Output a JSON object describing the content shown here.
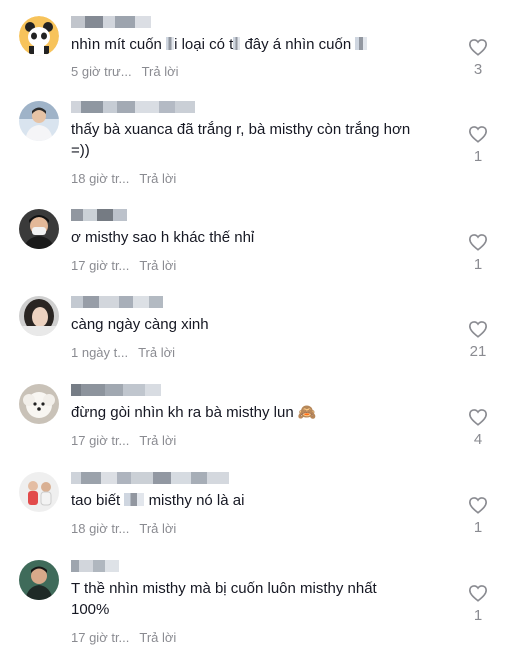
{
  "comments": [
    {
      "text_parts": [
        "nhìn mít cuốn",
        " ",
        "i loại có t",
        " ",
        "đây á nhìn cuốn",
        ""
      ],
      "time": "5 giờ trư...",
      "reply": "Trả lời",
      "likes": "3",
      "avatar": "panda-avatar"
    },
    {
      "text_parts": [
        "thấy bà xuanca đã trắng r, bà misthy còn trắng hơn\n=))"
      ],
      "time": "18 giờ tr...",
      "reply": "Trả lời",
      "likes": "1",
      "avatar": "person-avatar"
    },
    {
      "text_parts": [
        "ơ misthy sao h khác thế nhỉ"
      ],
      "time": "17 giờ tr...",
      "reply": "Trả lời",
      "likes": "1",
      "avatar": "masked-person-avatar"
    },
    {
      "text_parts": [
        "càng ngày càng xinh"
      ],
      "time": "1 ngày t...",
      "reply": "Trả lời",
      "likes": "21",
      "avatar": "girl-avatar"
    },
    {
      "text_parts": [
        "đừng gòi nhìn kh ra bà misthy lun 🙈"
      ],
      "time": "17 giờ tr...",
      "reply": "Trả lời",
      "likes": "4",
      "avatar": "dog-avatar"
    },
    {
      "text_parts": [
        "tao biết",
        " ",
        "mi",
        "misthy nó là ai"
      ],
      "time": "18 giờ tr...",
      "reply": "Trả lời",
      "likes": "1",
      "avatar": "group-avatar"
    },
    {
      "text_parts": [
        "T thề nhìn misthy mà bị cuốn luôn misthy nhất\n100%"
      ],
      "time": "17 giờ tr...",
      "reply": "Trả lời",
      "likes": "1",
      "avatar": "selfie-avatar"
    }
  ]
}
